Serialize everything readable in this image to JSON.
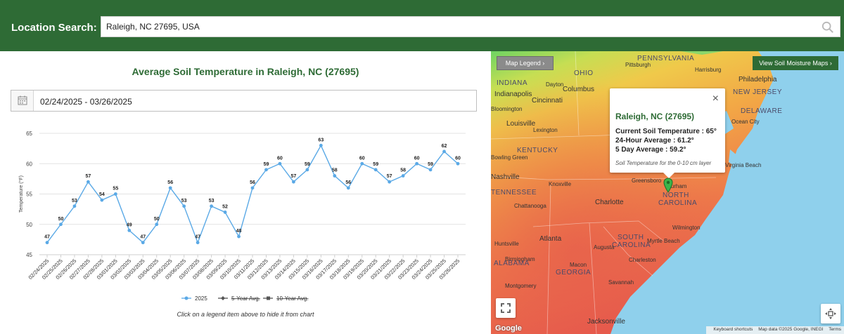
{
  "header": {
    "label": "Location Search:",
    "search_value": "Raleigh, NC 27695, USA",
    "search_icon": "search-icon"
  },
  "chart_panel": {
    "title": "Average Soil Temperature in Raleigh, NC (27695)",
    "date_range": "02/24/2025 - 03/26/2025",
    "calendar_icon": "calendar-icon",
    "note": "Click on a legend item above to hide it from chart"
  },
  "chart_data": {
    "type": "line",
    "title": "Average Soil Temperature in Raleigh, NC (27695)",
    "xlabel": "",
    "ylabel": "Temperature (°F)",
    "ylim": [
      45,
      65
    ],
    "yticks": [
      45,
      50,
      55,
      60,
      65
    ],
    "grid": true,
    "legend_placement": "bottom",
    "categories": [
      "02/24/2025",
      "02/25/2025",
      "02/26/2025",
      "02/27/2025",
      "02/28/2025",
      "03/01/2025",
      "03/02/2025",
      "03/03/2025",
      "03/04/2025",
      "03/05/2025",
      "03/06/2025",
      "03/07/2025",
      "03/08/2025",
      "03/09/2025",
      "03/10/2025",
      "03/11/2025",
      "03/12/2025",
      "03/13/2025",
      "03/14/2025",
      "03/15/2025",
      "03/16/2025",
      "03/17/2025",
      "03/18/2025",
      "03/19/2025",
      "03/20/2025",
      "03/21/2025",
      "03/22/2025",
      "03/23/2025",
      "03/24/2025",
      "03/25/2025",
      "03/26/2025"
    ],
    "series": [
      {
        "name": "2025",
        "color": "#5aa9e6",
        "hidden": false,
        "values": [
          47,
          50,
          53,
          57,
          54,
          55,
          49,
          47,
          50,
          56,
          53,
          47,
          53,
          52,
          48,
          56,
          59,
          60,
          57,
          59,
          63,
          58,
          56,
          60,
          59,
          57,
          58,
          60,
          59,
          62,
          60
        ]
      },
      {
        "name": "5-Year Avg.",
        "color": "#555555",
        "hidden": true,
        "values": []
      },
      {
        "name": "10-Year Avg.",
        "color": "#555555",
        "hidden": true,
        "values": []
      }
    ]
  },
  "map": {
    "legend_button": "Map Legend ›",
    "moisture_button": "View Soil Moisture Maps ›",
    "labels": {
      "pennsylvania": "PENNSYLVANIA",
      "pittsburgh": "Pittsburgh",
      "ohio": "OHIO",
      "harrisburg": "Harrisburg",
      "philadelphia": "Philadelphia",
      "new_jersey": "NEW JERSEY",
      "dayton": "Dayton",
      "columbus": "Columbus",
      "indiana": "INDIANA",
      "indianapolis": "Indianapolis",
      "bloomington": "Bloomington",
      "cincinnati": "Cincinnati",
      "louisville": "Louisville",
      "lexington": "Lexington",
      "kentucky": "KENTUCKY",
      "delaware": "DELAWARE",
      "ocean_city": "Ocean City",
      "virginia_beach": "Virginia Beach",
      "bowling_green": "Bowling Green",
      "nashville": "Nashville",
      "knoxville": "Knoxville",
      "greensboro": "Greensboro",
      "durham": "Durham",
      "tennessee": "TENNESSEE",
      "chattanooga": "Chattanooga",
      "charlotte": "Charlotte",
      "north_carolina_1": "NORTH",
      "north_carolina_2": "CAROLINA",
      "wilmington": "Wilmington",
      "south_carolina_1": "SOUTH",
      "south_carolina_2": "CAROLINA",
      "atlanta": "Atlanta",
      "augusta": "Augusta",
      "myrtle_beach": "Myrtle Beach",
      "alabama": "ALABAMA",
      "georgia": "GEORGIA",
      "savannah": "Savannah",
      "jacksonville": "Jacksonville",
      "huntsville": "Huntsville",
      "birmingham": "Birmingham",
      "montgomery": "Montgomery",
      "charleston": "Charleston",
      "macon": "Macon"
    },
    "popup": {
      "title": "Raleigh, NC (27695)",
      "close": "×",
      "current": "Current Soil Temperature : 65°",
      "avg24": "24-Hour Average : 61.2°",
      "avg5": "5 Day Average : 59.2°",
      "note": "Soil Temperature for the 0-10 cm layer"
    },
    "attribution": {
      "google": "Google",
      "shortcuts": "Keyboard shortcuts",
      "data": "Map data ©2025 Google, INEGI",
      "terms": "Terms"
    },
    "fullscreen_icon": "fullscreen-icon",
    "recenter_icon": "recenter-icon",
    "pin_icon": "map-pin-icon"
  },
  "colors": {
    "brand_green": "#2e6b35",
    "series_2025": "#5aa9e6",
    "ocean": "#8fd0ec"
  }
}
